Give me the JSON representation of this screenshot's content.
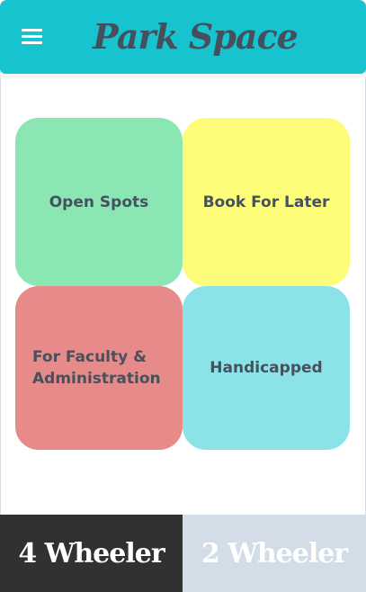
{
  "header": {
    "title": "Park Space",
    "menu_icon": "hamburger-menu-icon",
    "background": "#16c3cf"
  },
  "tiles": [
    {
      "label": "Open Spots",
      "color": "#8ae6b2"
    },
    {
      "label": "Book For Later",
      "color": "#fdfd7a"
    },
    {
      "label": "For Faculty & Administration",
      "color": "#e68a8a"
    },
    {
      "label": "Handicapped",
      "color": "#8be3e8"
    }
  ],
  "vehicle_tabs": [
    {
      "label": "4 Wheeler",
      "selected": true,
      "color": "#313131"
    },
    {
      "label": "2 Wheeler",
      "selected": false,
      "color": "#d3dde7"
    }
  ]
}
